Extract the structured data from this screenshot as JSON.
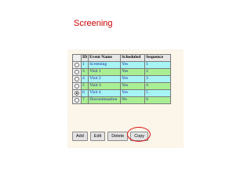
{
  "title": "Screening",
  "table": {
    "headers": [
      "",
      "ID",
      "Event Name",
      "Scheduled",
      "Sequence"
    ],
    "rows": [
      {
        "selected": false,
        "id": "1",
        "name": "Screening",
        "scheduled": "Yes",
        "sequence": "1"
      },
      {
        "selected": false,
        "id": "3",
        "name": "Visit 1",
        "scheduled": "Yes",
        "sequence": "2"
      },
      {
        "selected": false,
        "id": "4",
        "name": "Visit 2",
        "scheduled": "Yes",
        "sequence": "3"
      },
      {
        "selected": false,
        "id": "5",
        "name": "Visit 3",
        "scheduled": "Yes",
        "sequence": "4"
      },
      {
        "selected": true,
        "id": "6",
        "name": "Visit 4",
        "scheduled": "Yes",
        "sequence": "5"
      },
      {
        "selected": false,
        "id": "7",
        "name": "Discontinuation",
        "scheduled": "No",
        "sequence": "0"
      }
    ]
  },
  "buttons": {
    "add": "Add",
    "edit": "Edit",
    "delete": "Delete",
    "copy": "Copy"
  },
  "colors": {
    "title": "#cc0000",
    "row_odd": "#a6f4f3",
    "row_even": "#a9ee93",
    "highlight_ring": "#dd1111",
    "panel": "#fbf5ea"
  }
}
